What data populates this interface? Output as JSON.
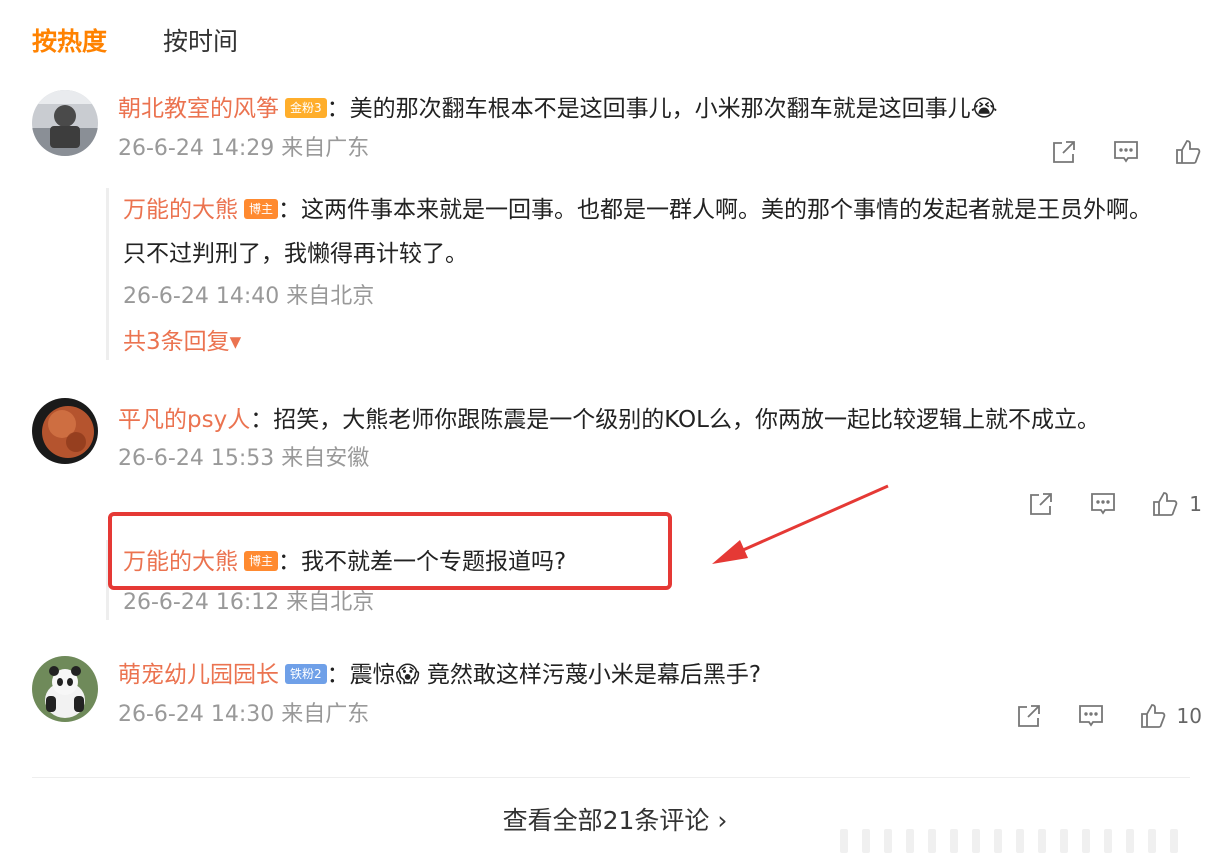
{
  "tabs": {
    "hot": "按热度",
    "time": "按时间"
  },
  "comments": [
    {
      "user": "朝北教室的风筝",
      "badge": "金粉3",
      "text": "：美的那次翻车根本不是这回事儿，小米那次翻车就是这回事儿",
      "emoji": "😭",
      "meta": "26-6-24 14:29 来自广东",
      "likes": ""
    },
    {
      "user": "平凡的psy人",
      "text": "：招笑，大熊老师你跟陈震是一个级别的KOL么，你两放一起比较逻辑上就不成立。",
      "meta": "26-6-24 15:53 来自安徽",
      "likes": "1"
    },
    {
      "user": "萌宠幼儿园园长",
      "badge": "铁粉2",
      "text_a": "：震惊",
      "emoji": "😱",
      "text_b": " 竟然敢这样污蔑小米是幕后黑手?",
      "meta": "26-6-24 14:30 来自广东",
      "likes": "10"
    }
  ],
  "replies": [
    {
      "user": "万能的大熊",
      "badge": "博主",
      "text": "：这两件事本来就是一回事。也都是一群人啊。美的那个事情的发起者就是王员外啊。只不过判刑了，我懒得再计较了。",
      "meta": "26-6-24 14:40 来自北京",
      "more": "共3条回复▾"
    },
    {
      "user": "万能的大熊",
      "badge": "博主",
      "text": "：我不就差一个专题报道吗?",
      "meta": "26-6-24 16:12 来自北京"
    }
  ],
  "view_all": "查看全部21条评论 ›",
  "colors": {
    "accent": "#ff8200",
    "username": "#eb7350",
    "highlight": "#e53935"
  }
}
